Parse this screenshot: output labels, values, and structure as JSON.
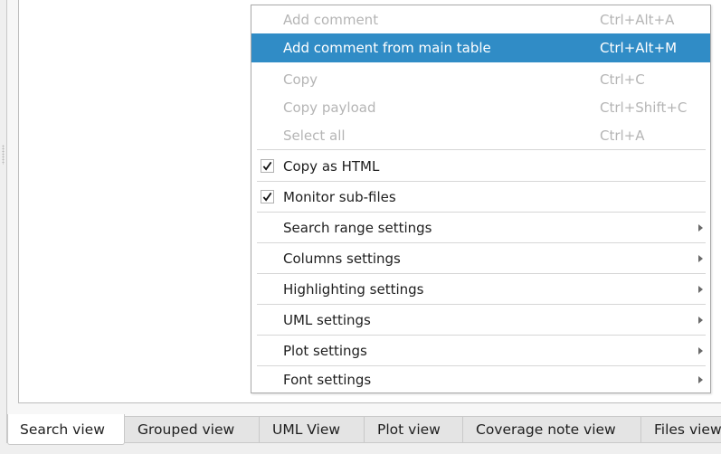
{
  "context_menu": {
    "items": [
      {
        "label": "Add comment",
        "shortcut": "Ctrl+Alt+A",
        "state": "disabled"
      },
      {
        "label": "Add comment from main table",
        "shortcut": "Ctrl+Alt+M",
        "state": "highlighted"
      },
      {
        "label": "Copy",
        "shortcut": "Ctrl+C",
        "state": "disabled"
      },
      {
        "label": "Copy payload",
        "shortcut": "Ctrl+Shift+C",
        "state": "disabled"
      },
      {
        "label": "Select all",
        "shortcut": "Ctrl+A",
        "state": "disabled"
      },
      {
        "label": "Copy as HTML",
        "checked": true
      },
      {
        "label": "Monitor sub-files",
        "checked": true
      },
      {
        "label": "Search range settings",
        "submenu": true
      },
      {
        "label": "Columns settings",
        "submenu": true
      },
      {
        "label": "Highlighting settings",
        "submenu": true
      },
      {
        "label": "UML settings",
        "submenu": true
      },
      {
        "label": "Plot settings",
        "submenu": true
      },
      {
        "label": "Font settings",
        "submenu": true
      }
    ]
  },
  "tabs": [
    {
      "label": "Search view",
      "active": true
    },
    {
      "label": "Grouped view"
    },
    {
      "label": "UML View"
    },
    {
      "label": "Plot view"
    },
    {
      "label": "Coverage note view"
    },
    {
      "label": "Files view"
    }
  ],
  "colors": {
    "highlight": "#308cc6",
    "disabled_text": "#b5b5b5"
  }
}
